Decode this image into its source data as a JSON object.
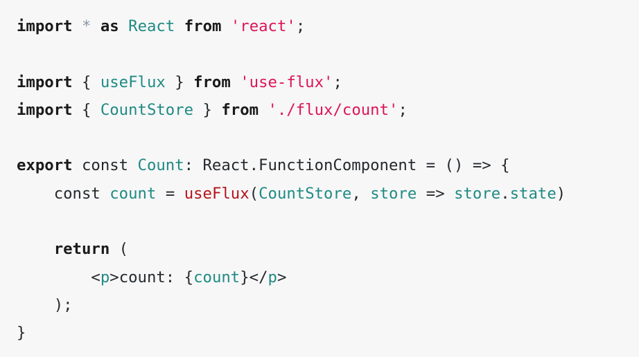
{
  "theme": {
    "background": "#f7f7f7",
    "text": "#24292e",
    "keyword": "#1a1a1a",
    "identifier": "#1f8a84",
    "string": "#dc1556",
    "call": "#b5121b",
    "operator_dim": "#8a97a6"
  },
  "code": {
    "lines": [
      [
        {
          "text": "import",
          "type": "kw"
        },
        {
          "text": " ",
          "type": "default"
        },
        {
          "text": "*",
          "type": "dim"
        },
        {
          "text": " ",
          "type": "default"
        },
        {
          "text": "as",
          "type": "kw"
        },
        {
          "text": " ",
          "type": "default"
        },
        {
          "text": "React",
          "type": "ident"
        },
        {
          "text": " ",
          "type": "default"
        },
        {
          "text": "from",
          "type": "kw"
        },
        {
          "text": " ",
          "type": "default"
        },
        {
          "text": "'react'",
          "type": "str"
        },
        {
          "text": ";",
          "type": "punct"
        }
      ],
      [],
      [
        {
          "text": "import",
          "type": "kw"
        },
        {
          "text": " { ",
          "type": "punct"
        },
        {
          "text": "useFlux",
          "type": "ident"
        },
        {
          "text": " } ",
          "type": "punct"
        },
        {
          "text": "from",
          "type": "kw"
        },
        {
          "text": " ",
          "type": "default"
        },
        {
          "text": "'use-flux'",
          "type": "str"
        },
        {
          "text": ";",
          "type": "punct"
        }
      ],
      [
        {
          "text": "import",
          "type": "kw"
        },
        {
          "text": " { ",
          "type": "punct"
        },
        {
          "text": "CountStore",
          "type": "ident"
        },
        {
          "text": " } ",
          "type": "punct"
        },
        {
          "text": "from",
          "type": "kw"
        },
        {
          "text": " ",
          "type": "default"
        },
        {
          "text": "'./flux/count'",
          "type": "str"
        },
        {
          "text": ";",
          "type": "punct"
        }
      ],
      [],
      [
        {
          "text": "export",
          "type": "kw"
        },
        {
          "text": " const ",
          "type": "plain-kw"
        },
        {
          "text": "Count",
          "type": "ident"
        },
        {
          "text": ": React.FunctionComponent ",
          "type": "default"
        },
        {
          "text": "=",
          "type": "op"
        },
        {
          "text": " () ",
          "type": "punct"
        },
        {
          "text": "=>",
          "type": "op"
        },
        {
          "text": " {",
          "type": "punct"
        }
      ],
      [
        {
          "text": "    const ",
          "type": "plain-kw"
        },
        {
          "text": "count",
          "type": "ident"
        },
        {
          "text": " ",
          "type": "default"
        },
        {
          "text": "=",
          "type": "op"
        },
        {
          "text": " ",
          "type": "default"
        },
        {
          "text": "useFlux",
          "type": "call"
        },
        {
          "text": "(",
          "type": "punct"
        },
        {
          "text": "CountStore",
          "type": "ident"
        },
        {
          "text": ", ",
          "type": "punct"
        },
        {
          "text": "store",
          "type": "ident"
        },
        {
          "text": " ",
          "type": "default"
        },
        {
          "text": "=>",
          "type": "op"
        },
        {
          "text": " ",
          "type": "default"
        },
        {
          "text": "store",
          "type": "ident"
        },
        {
          "text": ".",
          "type": "punct"
        },
        {
          "text": "state",
          "type": "ident"
        },
        {
          "text": ")",
          "type": "punct"
        }
      ],
      [],
      [
        {
          "text": "    ",
          "type": "default"
        },
        {
          "text": "return",
          "type": "kw"
        },
        {
          "text": " (",
          "type": "punct"
        }
      ],
      [
        {
          "text": "        <",
          "type": "punct"
        },
        {
          "text": "p",
          "type": "ident"
        },
        {
          "text": ">count: {",
          "type": "default"
        },
        {
          "text": "count",
          "type": "ident"
        },
        {
          "text": "}</",
          "type": "punct"
        },
        {
          "text": "p",
          "type": "ident"
        },
        {
          "text": ">",
          "type": "punct"
        }
      ],
      [
        {
          "text": "    );",
          "type": "punct"
        }
      ],
      [
        {
          "text": "}",
          "type": "punct"
        }
      ]
    ]
  }
}
